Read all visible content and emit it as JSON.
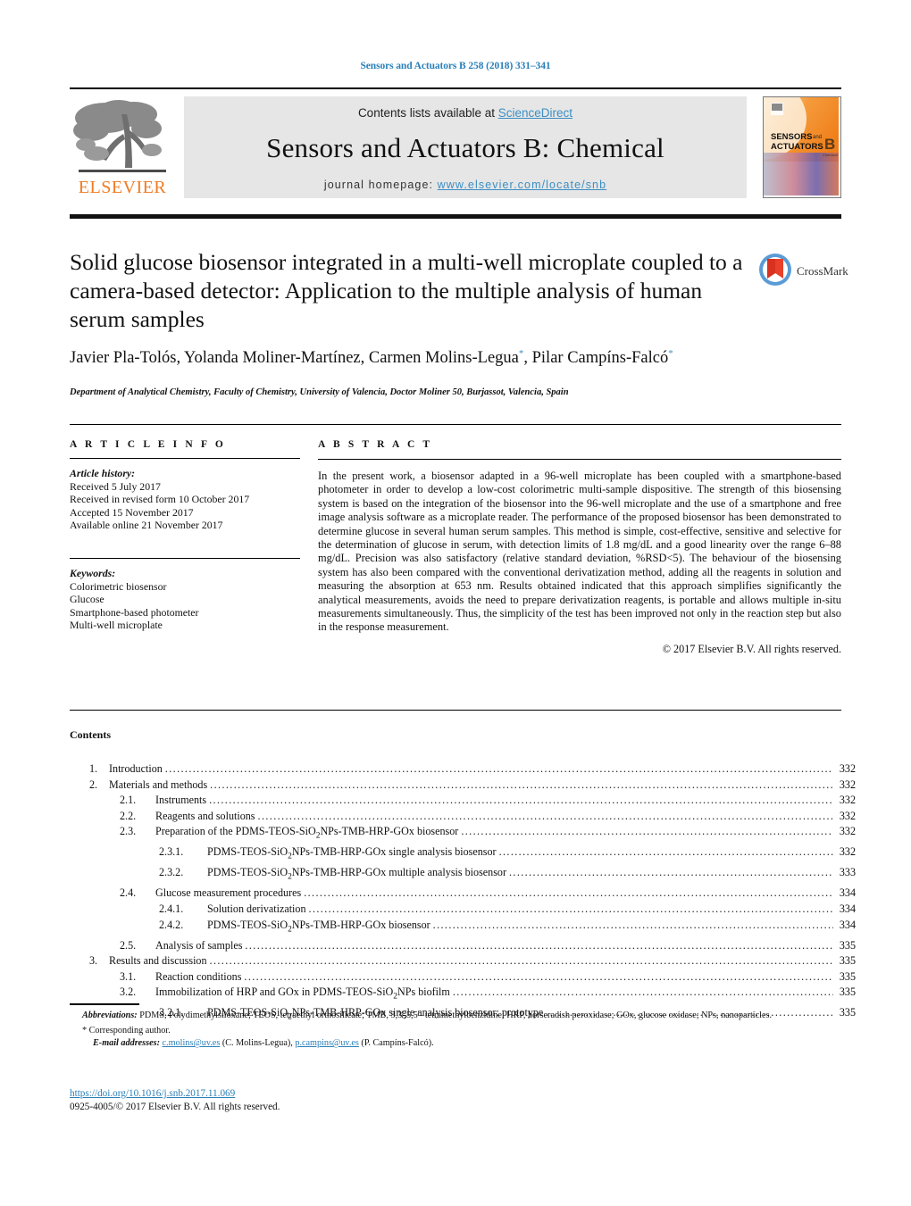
{
  "running_head": "Sensors and Actuators B 258 (2018) 331–341",
  "masthead": {
    "contents_prefix": "Contents lists available at ",
    "sciencedirect": "ScienceDirect",
    "journal_title": "Sensors and Actuators B: Chemical",
    "homepage_prefix": "journal homepage: ",
    "homepage_url": "www.elsevier.com/locate/snb",
    "publisher": "ELSEVIER",
    "cover_line1": "SENSORS",
    "cover_line1b": "and",
    "cover_line2": "ACTUATORS",
    "cover_letter": "B",
    "cover_sub": "Chemical",
    "accent_orange": "#F07C22",
    "link_blue": "#3c8fc4"
  },
  "article": {
    "title": "Solid glucose biosensor integrated in a multi-well microplate coupled to a camera-based detector: Application to the multiple analysis of human serum samples",
    "authors_html": "Javier Pla-Tolós, Yolanda Moliner-Martínez, Carmen Molins-Legua<sup>*</sup>, Pilar Campíns-Falcó<sup>*</sup>",
    "affiliation": "Department of Analytical Chemistry, Faculty of Chemistry, University of Valencia, Doctor Moliner 50, Burjassot, Valencia, Spain",
    "crossmark_label": "CrossMark"
  },
  "info": {
    "heading": "A R T I C L E   I N F O",
    "history_label": "Article history:",
    "history": [
      "Received 5 July 2017",
      "Received in revised form 10 October 2017",
      "Accepted 15 November 2017",
      "Available online 21 November 2017"
    ],
    "keywords_label": "Keywords:",
    "keywords": [
      "Colorimetric biosensor",
      "Glucose",
      "Smartphone-based photometer",
      "Multi-well microplate"
    ]
  },
  "abstract": {
    "heading": "A B S T R A C T",
    "text": "In the present work, a biosensor adapted in a 96-well microplate has been coupled with a smartphone-based photometer in order to develop a low-cost colorimetric multi-sample dispositive. The strength of this biosensing system is based on the integration of the biosensor into the 96-well microplate and the use of a smartphone and free image analysis software as a microplate reader. The performance of the proposed biosensor has been demonstrated to determine glucose in several human serum samples. This method is simple, cost-effective, sensitive and selective for the determination of glucose in serum, with detection limits of 1.8 mg/dL and a good linearity over the range 6–88 mg/dL. Precision was also satisfactory (relative standard deviation, %RSD<5). The behaviour of the biosensing system has also been compared with the conventional derivatization method, adding all the reagents in solution and measuring the absorption at 653 nm. Results obtained indicated that this approach simplifies significantly the analytical measurements, avoids the need to prepare derivatization reagents, is portable and allows multiple in-situ measurements simultaneously. Thus, the simplicity of the test has been improved not only in the reaction step but also in the response measurement.",
    "copyright": "© 2017 Elsevier B.V. All rights reserved."
  },
  "contents": {
    "heading": "Contents",
    "rows": [
      {
        "level": 1,
        "num": "1.",
        "label": "Introduction",
        "page": "332"
      },
      {
        "level": 1,
        "num": "2.",
        "label": "Materials and methods",
        "page": "332"
      },
      {
        "level": 2,
        "num": "2.1.",
        "label": "Instruments",
        "page": "332"
      },
      {
        "level": 2,
        "num": "2.2.",
        "label": "Reagents and solutions",
        "page": "332"
      },
      {
        "level": 2,
        "num": "2.3.",
        "label_html": "Preparation of the PDMS-TEOS-SiO<sub>2</sub>NPs-TMB-HRP-GOx biosensor",
        "page": "332"
      },
      {
        "level": 3,
        "num": "2.3.1.",
        "label_html": "PDMS-TEOS-SiO<sub>2</sub>NPs-TMB-HRP-GOx single analysis biosensor",
        "page": "332"
      },
      {
        "level": 3,
        "num": "2.3.2.",
        "label_html": "PDMS-TEOS-SiO<sub>2</sub>NPs-TMB-HRP-GOx multiple analysis biosensor",
        "page": "333"
      },
      {
        "level": 2,
        "num": "2.4.",
        "label": "Glucose measurement procedures",
        "page": "334"
      },
      {
        "level": 3,
        "num": "2.4.1.",
        "label": "Solution derivatization",
        "page": "334"
      },
      {
        "level": 3,
        "num": "2.4.2.",
        "label_html": "PDMS-TEOS-SiO<sub>2</sub>NPs-TMB-HRP-GOx biosensor",
        "page": "334"
      },
      {
        "level": 2,
        "num": "2.5.",
        "label": "Analysis of samples",
        "page": "335"
      },
      {
        "level": 1,
        "num": "3.",
        "label": "Results and discussion",
        "page": "335"
      },
      {
        "level": 2,
        "num": "3.1.",
        "label": "Reaction conditions",
        "page": "335"
      },
      {
        "level": 2,
        "num": "3.2.",
        "label_html": "Immobilization of HRP and GOx in PDMS-TEOS-SiO<sub>2</sub>NPs biofilm",
        "page": "335"
      },
      {
        "level": 3,
        "num": "3.2.1.",
        "label_html": "PDMS-TEOS-SiO<sub>2</sub>NPs-TMB-HRP-GOx single analysis biosensor: prototype",
        "page": "335"
      }
    ]
  },
  "footnotes": {
    "abbrev_label": "Abbreviations:",
    "abbrev_text": "PDMS, Polydimethylsiloxane; TEOS, tetraethyl orthosilicate; TMB, 3,3′,5,5′- tetramethylbenzidine; HRP, horseradish peroxidase; GOx, glucose oxidase; NPs, nanoparticles.",
    "corresponding": "* Corresponding author.",
    "email_label": "E-mail addresses:",
    "email1": "c.molins@uv.es",
    "email1_owner": "(C. Molins-Legua),",
    "email2": "p.campins@uv.es",
    "email2_owner": "(P. Campíns-Falcó).",
    "doi": "https://doi.org/10.1016/j.snb.2017.11.069",
    "issn_line": "0925-4005/© 2017 Elsevier B.V. All rights reserved."
  }
}
